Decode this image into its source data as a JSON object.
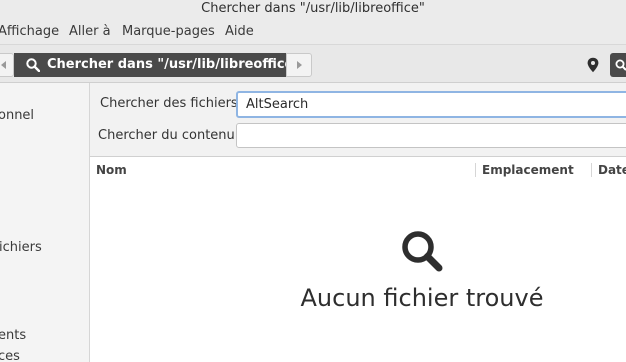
{
  "window": {
    "title": "Chercher dans \"/usr/lib/libreoffice\""
  },
  "menubar": {
    "items": [
      "Affichage",
      "Aller à",
      "Marque-pages",
      "Aide"
    ]
  },
  "toolbar": {
    "breadcrumb_label": "Chercher dans \"/usr/lib/libreoffice\""
  },
  "sidebar": {
    "items": [
      "onnel",
      "ichiers",
      "ents",
      "ces"
    ]
  },
  "search": {
    "files_label": "Chercher des fichiers :",
    "files_value": "AltSearch",
    "content_label": "Chercher du contenu :",
    "content_value": ""
  },
  "columns": [
    "Nom",
    "Emplacement",
    "Date"
  ],
  "empty_state": {
    "message": "Aucun fichier trouvé"
  },
  "icons": {
    "search": "search-icon",
    "back": "arrow-left-icon",
    "forward": "arrow-right-icon",
    "location": "location-pin-icon"
  },
  "colors": {
    "breadcrumb_bg": "#4a4a4a",
    "focus_border": "#8fb5e3"
  }
}
